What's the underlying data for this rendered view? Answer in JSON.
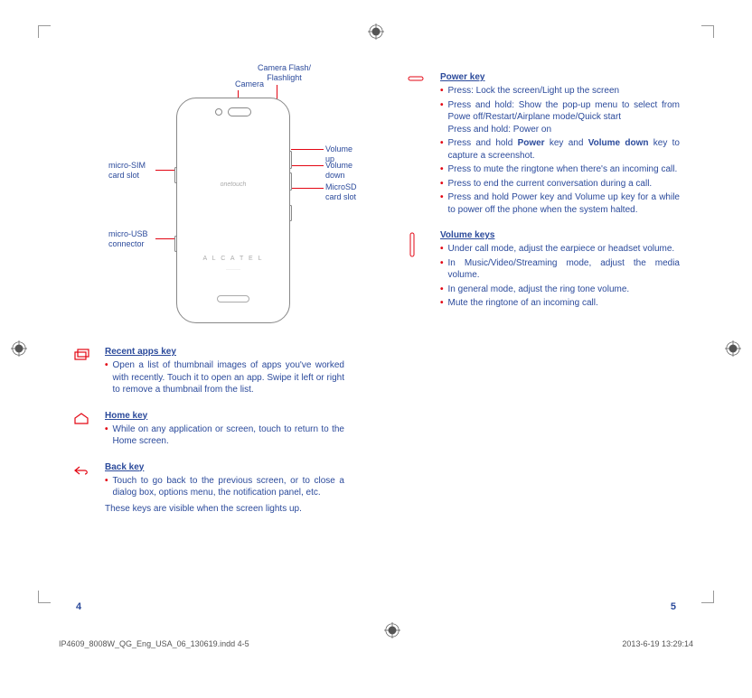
{
  "diagram": {
    "camera_label": "Camera",
    "flash_label": "Camera Flash/\nFlashlight",
    "volume_up_label": "Volume up",
    "volume_down_label": "Volume down",
    "microsd_label": "MicroSD card slot",
    "sim_label": "micro-SIM card slot",
    "usb_label": "micro-USB connector",
    "brand1": "onetouch",
    "brand2": "A L C A T E L"
  },
  "recent": {
    "title": "Recent apps key",
    "b1": "Open a list of thumbnail images of apps you've worked with recently. Touch it to open an app. Swipe it left or right to remove a thumbnail from the list."
  },
  "home": {
    "title": "Home key",
    "b1": "While on any application or screen,  touch to return to the Home screen."
  },
  "back": {
    "title": "Back key",
    "b1": "Touch to go back to the previous screen, or to close a dialog box, options menu, the notification panel, etc.",
    "note": "These keys are visible when the screen lights up."
  },
  "power": {
    "title": "Power key",
    "b1": "Press: Lock the screen/Light up the screen",
    "b2": "Press and hold: Show the pop-up menu to select from Powe off/Restart/Airplane mode/Quick start\nPress and hold: Power on",
    "b3_a": "Press and hold ",
    "b3_b": "Power",
    "b3_c": " key and ",
    "b3_d": "Volume down",
    "b3_e": " key to capture a screenshot.",
    "b4": "Press to mute the ringtone when there's an incoming call.",
    "b5": "Press to end the current conversation during a call.",
    "b6": "Press and hold Power key and  Volume up key for a while to power off the phone when the system halted."
  },
  "volume": {
    "title": "Volume keys",
    "b1": "Under call mode, adjust the earpiece or headset volume.",
    "b2": "In Music/Video/Streaming mode, adjust the media volume.",
    "b3": "In general mode, adjust the ring tone volume.",
    "b4": "Mute the ringtone of an incoming call."
  },
  "page_left": "4",
  "page_right": "5",
  "footer_file": "IP4609_8008W_QG_Eng_USA_06_130619.indd   4-5",
  "footer_time": "2013-6-19   13:29:14"
}
